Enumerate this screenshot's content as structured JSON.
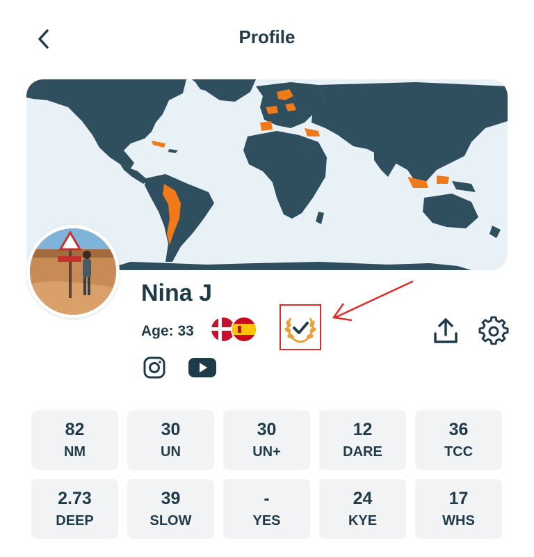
{
  "header": {
    "title": "Profile",
    "back_icon": "chevron-left-icon"
  },
  "profile": {
    "name": "Nina J",
    "age": "Age: 33",
    "flags": [
      "Denmark",
      "Spain"
    ],
    "verified_icon": "laurel-check-icon"
  },
  "actions": {
    "share_icon": "upload-icon",
    "settings_icon": "gear-icon"
  },
  "social": {
    "instagram_icon": "instagram-icon",
    "youtube_icon": "youtube-icon"
  },
  "stats": [
    {
      "value": "82",
      "label": "NM"
    },
    {
      "value": "30",
      "label": "UN"
    },
    {
      "value": "30",
      "label": "UN+"
    },
    {
      "value": "12",
      "label": "DARE"
    },
    {
      "value": "36",
      "label": "TCC"
    },
    {
      "value": "2.73",
      "label": "DEEP"
    },
    {
      "value": "39",
      "label": "SLOW"
    },
    {
      "value": "-",
      "label": "YES"
    },
    {
      "value": "24",
      "label": "KYE"
    },
    {
      "value": "17",
      "label": "WHS"
    }
  ],
  "colors": {
    "primary": "#1f3b4a",
    "visited": "#f07a1a",
    "map_land": "#2f4e5e",
    "map_ocean": "#e8f1f6",
    "highlight": "#e02a2a",
    "tile_bg": "#f2f3f4"
  }
}
